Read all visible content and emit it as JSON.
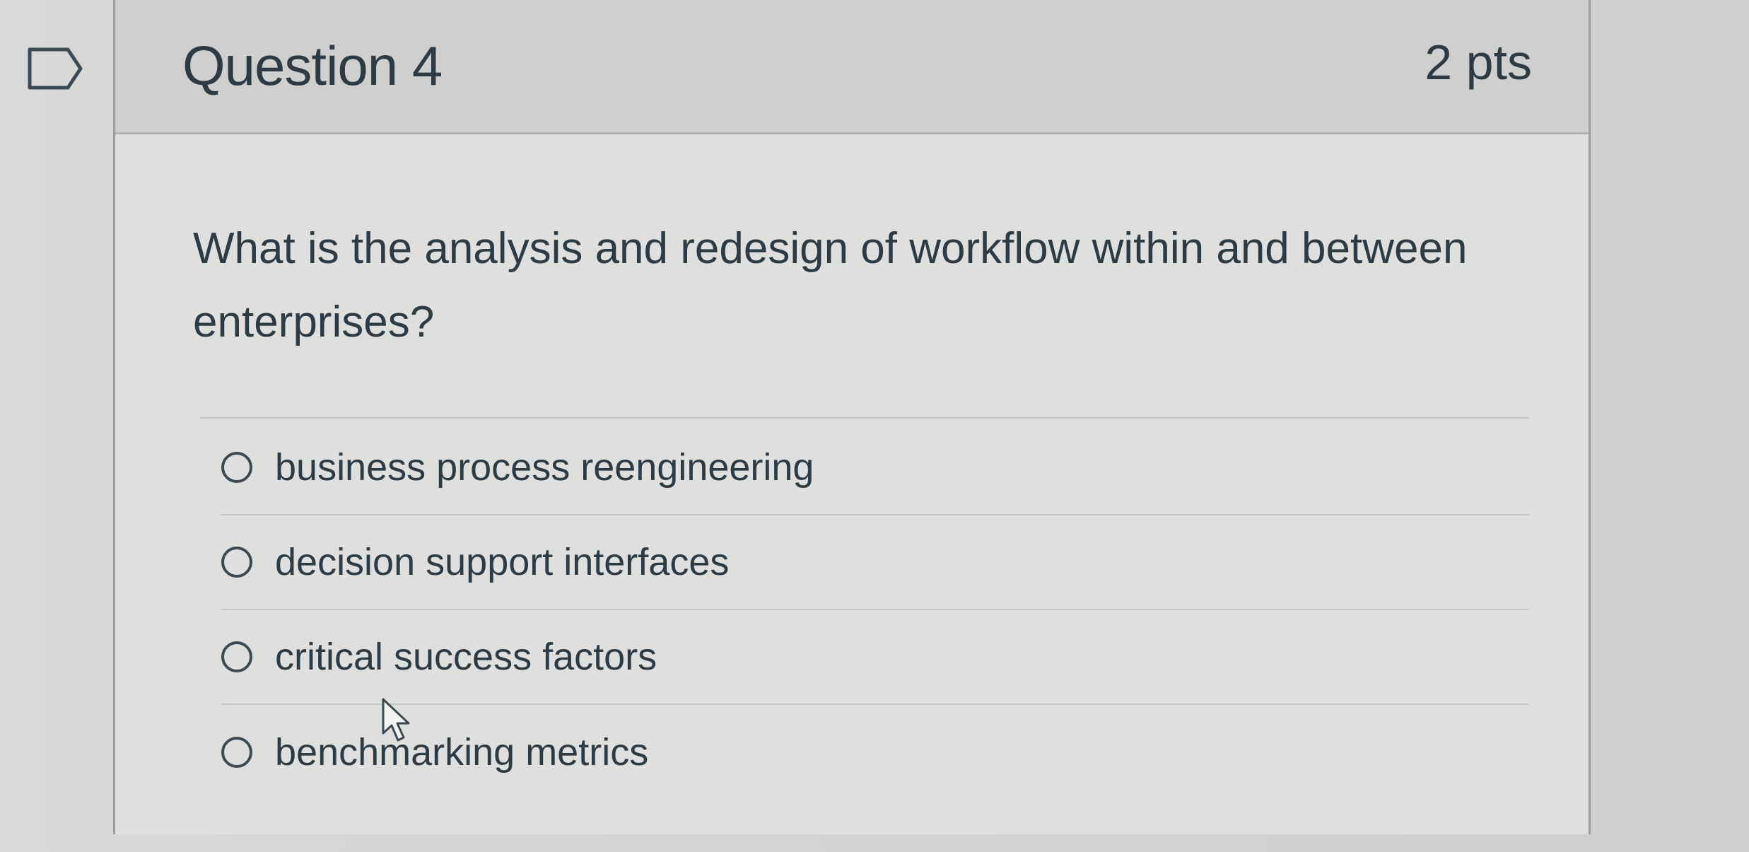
{
  "question": {
    "title": "Question 4",
    "points": "2 pts",
    "prompt": "What is the analysis and redesign of workflow within and between enterprises?"
  },
  "answers": [
    {
      "label": "business process reengineering",
      "selected": false
    },
    {
      "label": "decision support interfaces",
      "selected": false
    },
    {
      "label": "critical success factors",
      "selected": false
    },
    {
      "label": "benchmarking metrics",
      "selected": false
    }
  ],
  "icons": {
    "flag": "flag-outline-icon",
    "cursor": "mouse-pointer-icon"
  },
  "colors": {
    "text": "#2d3b45",
    "border": "#9c9c9a",
    "header_bg": "#cfcfcd",
    "body_bg": "#dfdfdd"
  }
}
